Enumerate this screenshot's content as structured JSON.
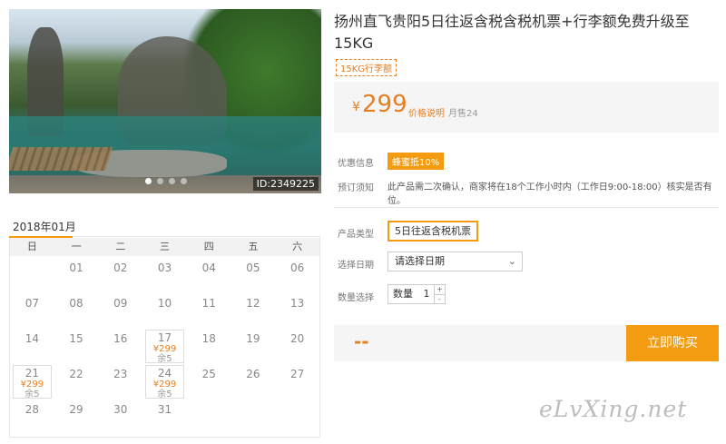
{
  "photo": {
    "id_label": "ID:2349225",
    "slide_count": 4,
    "active_slide": 0
  },
  "calendar": {
    "month_label": "2018年01月",
    "weekdays": [
      "日",
      "一",
      "二",
      "三",
      "四",
      "五",
      "六"
    ],
    "days": [
      {
        "num": ""
      },
      {
        "num": "01"
      },
      {
        "num": "02"
      },
      {
        "num": "03"
      },
      {
        "num": "04"
      },
      {
        "num": "05"
      },
      {
        "num": "06"
      },
      {
        "num": "07"
      },
      {
        "num": "08"
      },
      {
        "num": "09"
      },
      {
        "num": "10"
      },
      {
        "num": "11"
      },
      {
        "num": "12"
      },
      {
        "num": "13"
      },
      {
        "num": "14"
      },
      {
        "num": "15"
      },
      {
        "num": "16"
      },
      {
        "num": "17",
        "price": "¥299",
        "stock": "余5"
      },
      {
        "num": "18"
      },
      {
        "num": "19"
      },
      {
        "num": "20"
      },
      {
        "num": "21",
        "price": "¥299",
        "stock": "余5"
      },
      {
        "num": "22"
      },
      {
        "num": "23"
      },
      {
        "num": "24",
        "price": "¥299",
        "stock": "余5"
      },
      {
        "num": "25"
      },
      {
        "num": "26"
      },
      {
        "num": "27"
      },
      {
        "num": "28"
      },
      {
        "num": "29"
      },
      {
        "num": "30"
      },
      {
        "num": "31"
      }
    ]
  },
  "product": {
    "title": "扬州直飞贵阳5日往返含税含税机票+行李额免费升级至15KG",
    "tag": "15KG行李额",
    "price_symbol": "¥",
    "price": "299",
    "price_explain": "价格说明",
    "monthly_sales": "月售24"
  },
  "info": {
    "discount_label": "优惠信息",
    "discount_value": "蜂蜜抵10%",
    "booking_label": "预订须知",
    "booking_note": "此产品需二次确认，商家将在18个工作小时内（工作日9:00-18:00）核实是否有位。"
  },
  "options": {
    "type_label": "产品类型",
    "type_value": "5日往返含税机票",
    "date_label": "选择日期",
    "date_placeholder": "请选择日期",
    "qty_label": "数量选择",
    "qty_prefix": "数量",
    "qty_value": "1",
    "qty_plus": "+",
    "qty_minus": "-"
  },
  "buy": {
    "total": "--",
    "button_label": "立即购买"
  },
  "watermark": "eLvXing.net",
  "colors": {
    "accent": "#f39c12",
    "price": "#e67e22"
  }
}
